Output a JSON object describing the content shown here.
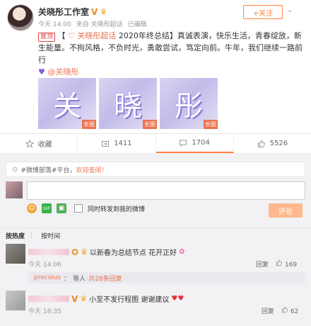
{
  "post": {
    "author": "关晓彤工作室",
    "verified_badge": "V",
    "meta_time": "今天 14:00",
    "meta_from": "来自 关晓彤超话",
    "meta_edited": "已编辑",
    "follow_label": "+关注",
    "more_label": "⌄",
    "badge": "置顶",
    "bracket_open": "【",
    "topic": "关晓彤超话",
    "text": "2020年终总结】真诚表演，快乐生活，青春绽放，新生能量。不拘风格，不负时光，勇敢尝试，笃定向前。牛年，我们继续一路前行",
    "mention": "@关晓彤",
    "images": [
      {
        "char": "关",
        "tag": "长图"
      },
      {
        "char": "晓",
        "tag": "长图"
      },
      {
        "char": "彤",
        "tag": "长图"
      }
    ]
  },
  "actions": [
    {
      "label": "收藏",
      "icon": "star-icon"
    },
    {
      "label": "1411",
      "icon": "repost-icon"
    },
    {
      "label": "1704",
      "icon": "comment-icon"
    },
    {
      "label": "5526",
      "icon": "like-icon"
    }
  ],
  "comment_box": {
    "notice_prefix": "#微博部落#平台，",
    "notice_link": "欢迎查阅！",
    "checkbox_label": "同时转发到我的微博",
    "submit_label": "评论"
  },
  "sort": {
    "hot": "按热度",
    "time": "按时间"
  },
  "comments": [
    {
      "text": "以新春为总结节点 花开正好",
      "time": "今天 14:06",
      "reply_label": "回复",
      "likes": "169",
      "reply_preview": {
        "user": "precious",
        "text": "等人",
        "count": "共28条回复"
      }
    },
    {
      "text": "小至不发行程图 谢谢建议",
      "time": "今天 18:35",
      "reply_label": "回复",
      "likes": "62"
    }
  ]
}
